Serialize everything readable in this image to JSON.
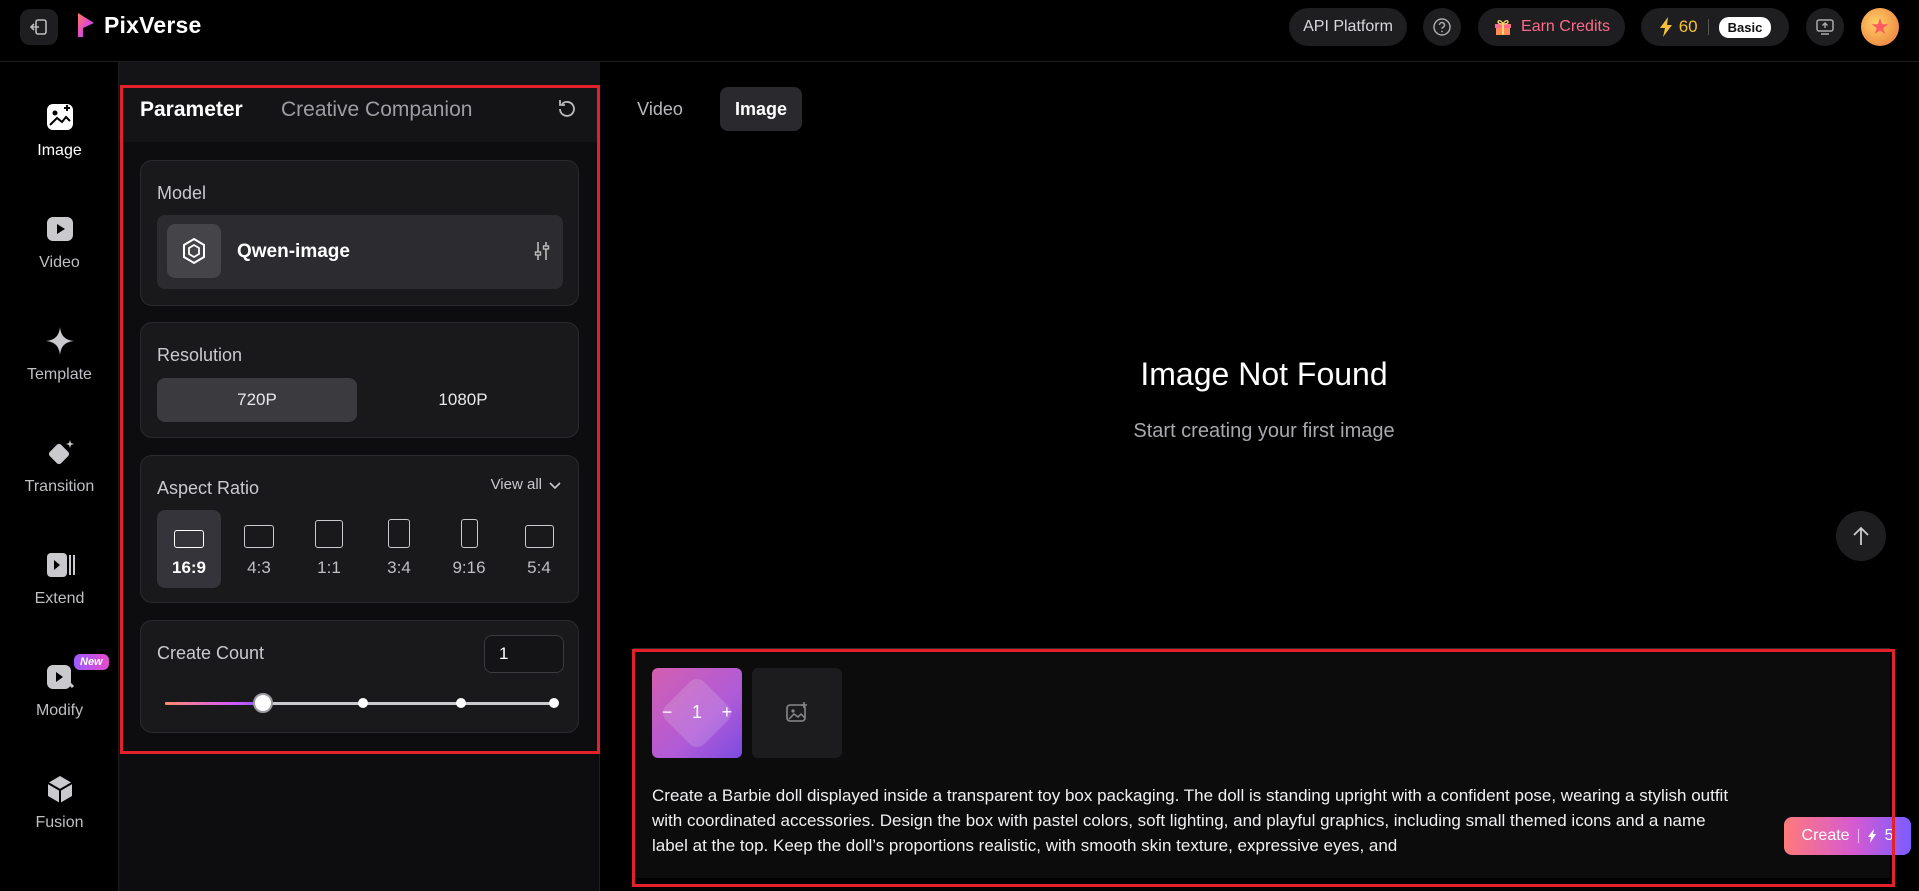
{
  "topbar": {
    "app_name": "PixVerse",
    "api_label": "API Platform",
    "earn_label": "Earn Credits",
    "credits": "60",
    "plan": "Basic"
  },
  "nav": {
    "items": [
      {
        "label": "Image",
        "icon": "image-icon"
      },
      {
        "label": "Video",
        "icon": "video-icon"
      },
      {
        "label": "Template",
        "icon": "sparkle-icon"
      },
      {
        "label": "Transition",
        "icon": "transition-icon"
      },
      {
        "label": "Extend",
        "icon": "extend-icon"
      },
      {
        "label": "Modify",
        "icon": "modify-icon",
        "badge": "New"
      },
      {
        "label": "Fusion",
        "icon": "fusion-icon"
      }
    ]
  },
  "params": {
    "tab_active": "Parameter",
    "tab_other": "Creative Companion",
    "model_title": "Model",
    "model_name": "Qwen-image",
    "resolution_title": "Resolution",
    "res_options": [
      "720P",
      "1080P"
    ],
    "res_selected": "720P",
    "aspect_title": "Aspect Ratio",
    "view_all": "View all",
    "ratios": [
      "16:9",
      "4:3",
      "1:1",
      "3:4",
      "9:16",
      "5:4"
    ],
    "ratio_selected": "16:9",
    "count_title": "Create Count",
    "count_value": "1",
    "count_slider_fraction": 0.25
  },
  "main": {
    "tab_video": "Video",
    "tab_image": "Image",
    "empty_title": "Image Not Found",
    "empty_sub": "Start creating your first image",
    "gen_count": "1",
    "prompt": "Create a Barbie doll displayed inside a transparent toy box packaging. The doll is standing upright with a confident pose, wearing a stylish outfit with coordinated accessories. Design the box with pastel colors, soft lighting, and playful graphics, including small themed icons and a name label at the top. Keep the doll’s proportions realistic, with smooth skin texture, expressive eyes, and",
    "create_label": "Create",
    "create_cost": "5"
  },
  "colors": {
    "accent_red_frame": "#e4212b",
    "credit_yellow": "#f5c13a",
    "earn_pink": "#ff6a8a"
  }
}
